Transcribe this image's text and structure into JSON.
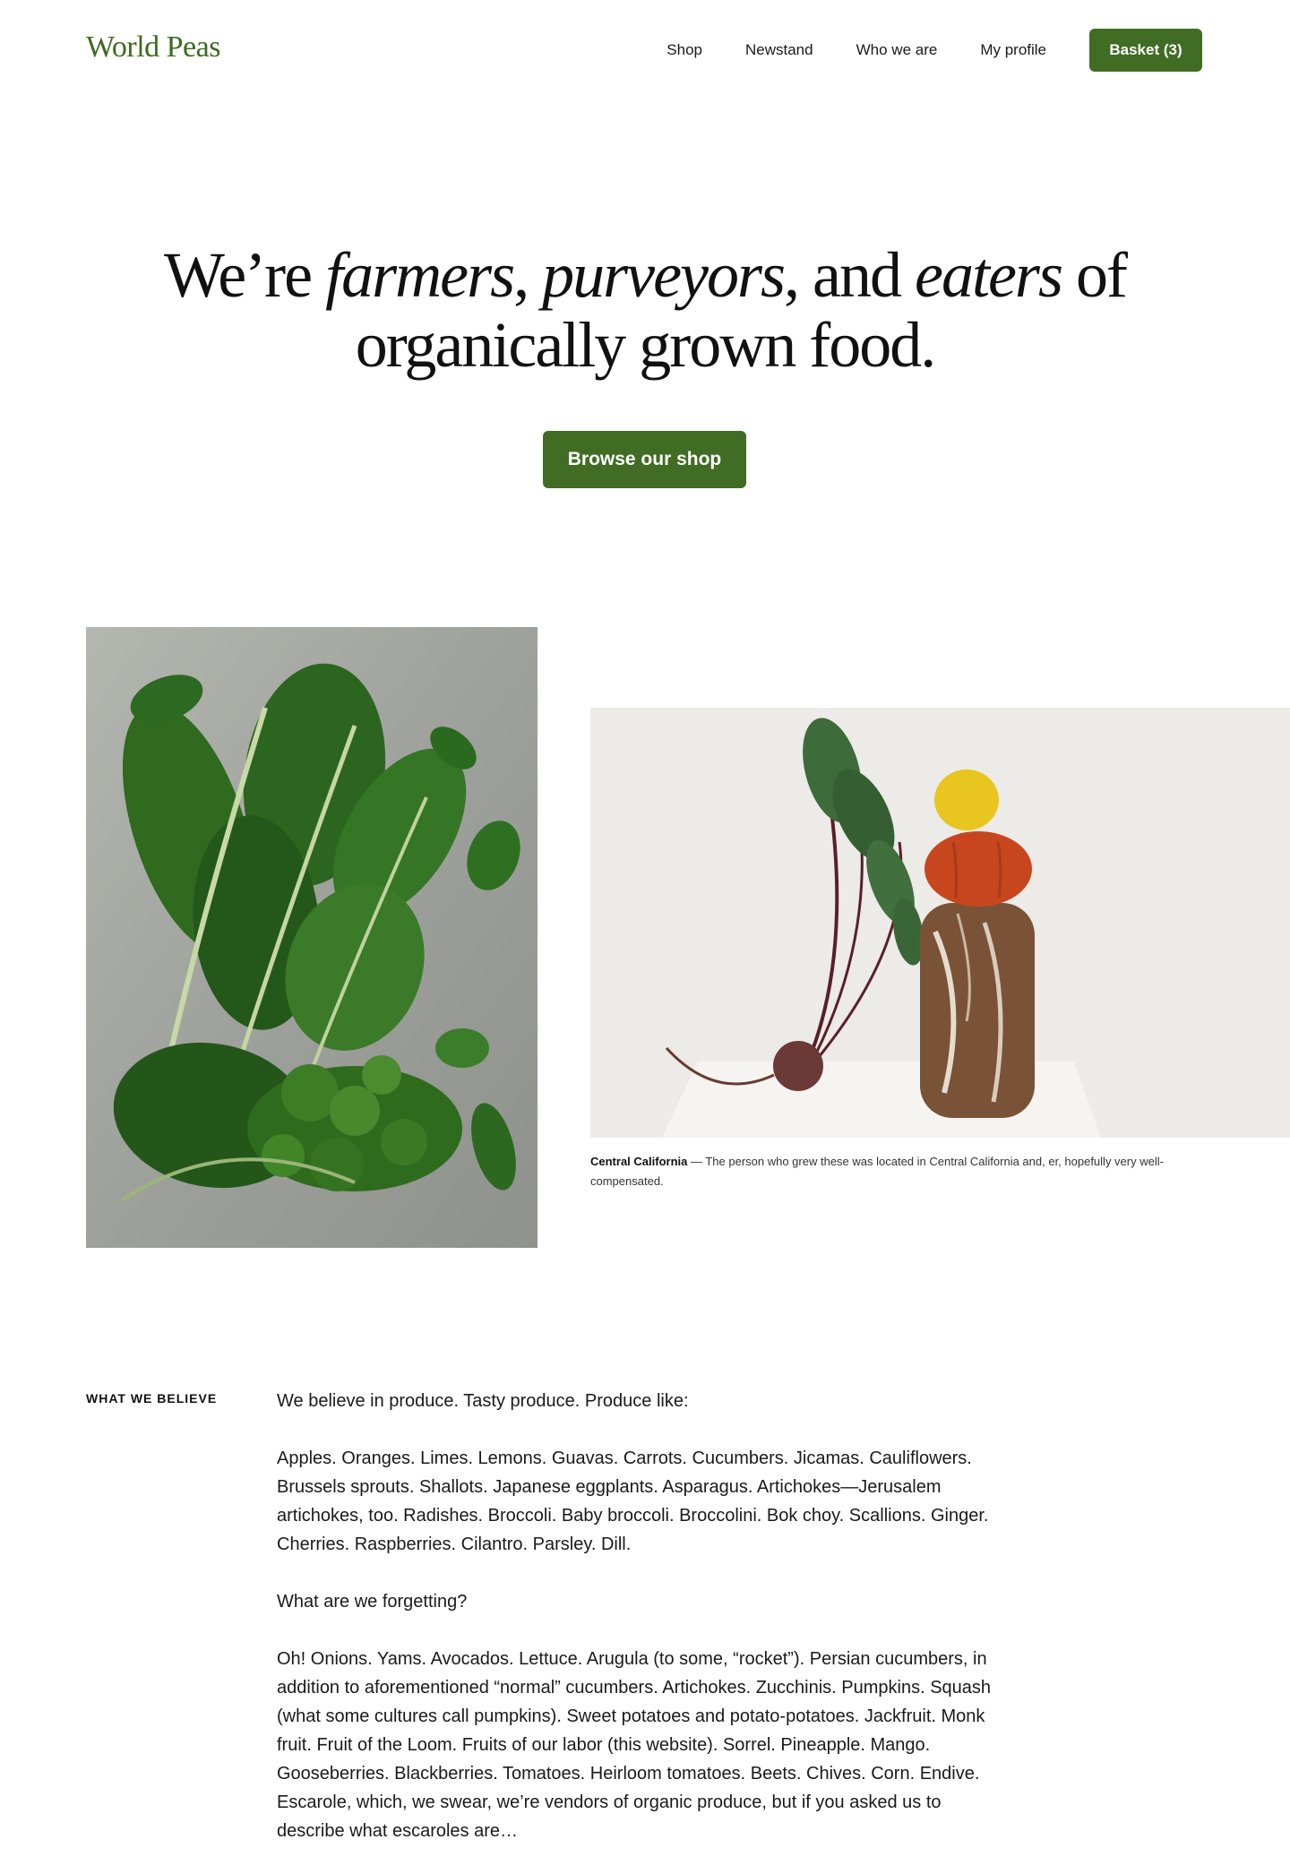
{
  "header": {
    "logo": "World Peas",
    "nav": [
      "Shop",
      "Newstand",
      "Who we are",
      "My profile"
    ],
    "basket_label": "Basket (3)"
  },
  "hero": {
    "parts": [
      "We’re ",
      "farmers",
      ", ",
      "purveyors",
      ", and ",
      "eaters",
      " of",
      "organically grown food."
    ],
    "cta_label": "Browse our shop"
  },
  "images": {
    "greens_alt": "Leafy greens: chard, spinach and kale",
    "stack_alt": "Beet leaning on a loaf of bread topped with a tomato and a lemon"
  },
  "caption": {
    "location": "Central California",
    "text": " — The person who grew these was located in Central California and, er, hopefully very well-compensated."
  },
  "belief": {
    "label": "WHAT WE BELIEVE",
    "paragraphs": [
      "We believe in produce. Tasty produce. Produce like:",
      "Apples. Oranges. Limes. Lemons. Guavas. Carrots. Cucumbers. Jicamas. Cauliflowers. Brussels sprouts. Shallots. Japanese eggplants. Asparagus. Artichokes—Jerusalem artichokes, too. Radishes. Broccoli. Baby broccoli. Broccolini. Bok choy. Scallions. Ginger. Cherries. Raspberries. Cilantro. Parsley. Dill.",
      "What are we forgetting?",
      "Oh! Onions. Yams. Avocados. Lettuce. Arugula (to some, “rocket”). Persian cucumbers, in addition to aforementioned “normal” cucumbers. Artichokes. Zucchinis. Pumpkins. Squash (what some cultures call pumpkins). Sweet potatoes and potato-potatoes. Jackfruit. Monk fruit. Fruit of the Loom. Fruits of our labor (this website). Sorrel. Pineapple. Mango. Gooseberries. Blackberries. Tomatoes. Heirloom tomatoes. Beets. Chives. Corn. Endive. Escarole, which, we swear, we’re vendors of organic produce, but if you asked us to describe what escaroles are…"
    ]
  },
  "colors": {
    "brand_green": "#416c24",
    "logo_green": "#3d6b20",
    "text": "#111111"
  }
}
